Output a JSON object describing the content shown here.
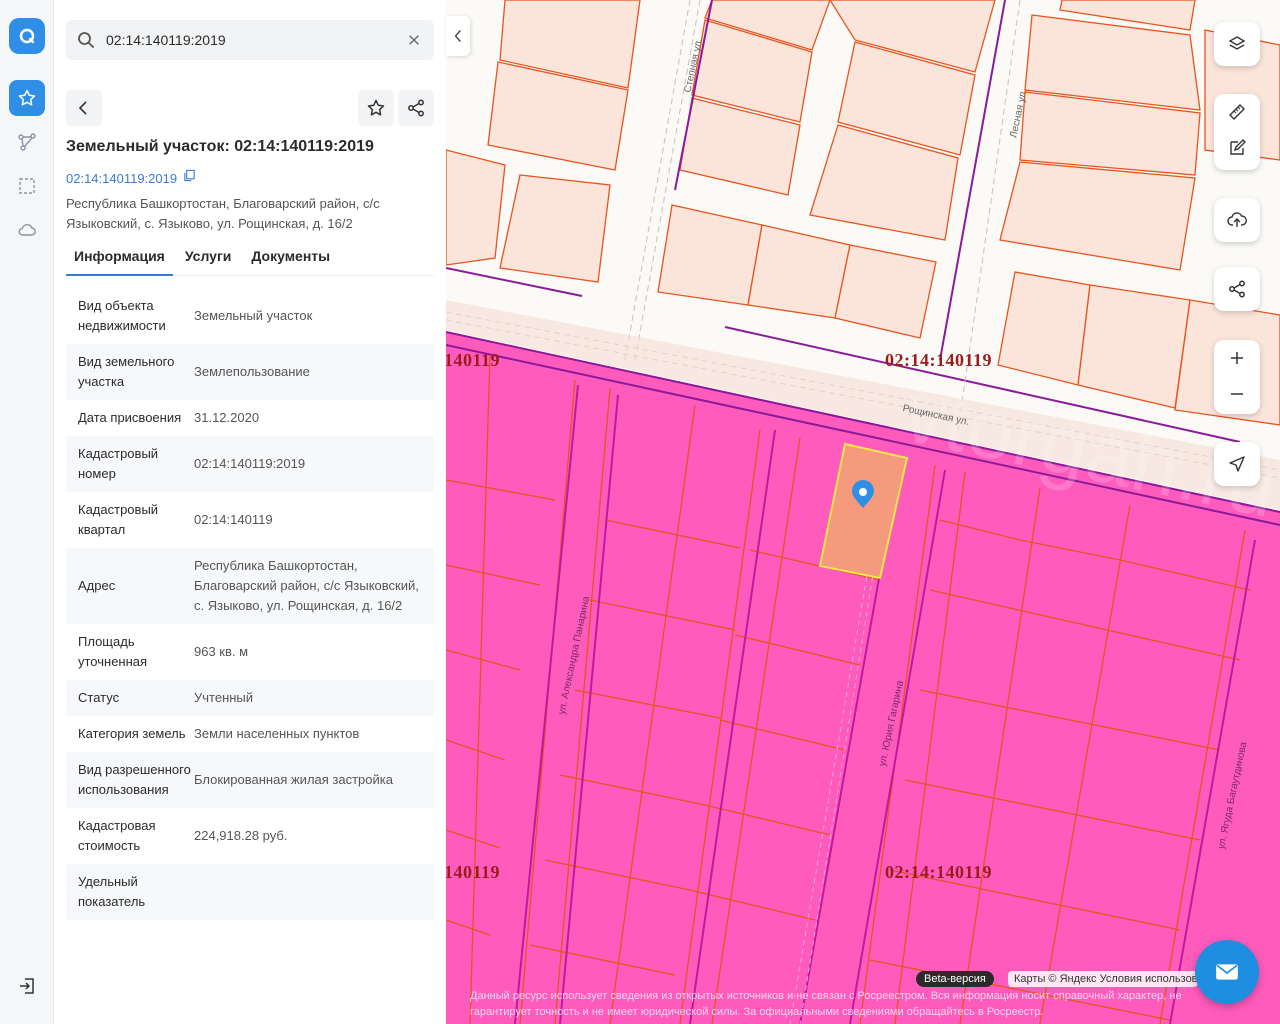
{
  "search": {
    "value": "02:14:140119:2019"
  },
  "object": {
    "title": "Земельный участок: 02:14:140119:2019",
    "cadastral_link": "02:14:140119:2019",
    "address": "Республика Башкортостан, Благоварский район, с/с Языковский, с. Языково, ул. Рощинская, д. 16/2"
  },
  "tabs": [
    {
      "label": "Информация",
      "active": true
    },
    {
      "label": "Услуги",
      "active": false
    },
    {
      "label": "Документы",
      "active": false
    }
  ],
  "info_rows": [
    {
      "key": "Вид объекта недвижимости",
      "value": "Земельный участок"
    },
    {
      "key": "Вид земельного участка",
      "value": "Землепользование"
    },
    {
      "key": "Дата присвоения",
      "value": "31.12.2020"
    },
    {
      "key": "Кадастровый номер",
      "value": "02:14:140119:2019"
    },
    {
      "key": "Кадастровый квартал",
      "value": "02:14:140119"
    },
    {
      "key": "Адрес",
      "value": "Республика Башкортостан, Благоварский район, с/с Языковский, с. Языково, ул. Рощинская, д. 16/2"
    },
    {
      "key": "Площадь уточненная",
      "value": "963 кв. м"
    },
    {
      "key": "Статус",
      "value": "Учтенный"
    },
    {
      "key": "Категория земель",
      "value": "Земли населенных пунктов"
    },
    {
      "key": "Вид разрешенного использования",
      "value": "Блокированная жилая застройка"
    },
    {
      "key": "Кадастровая стоимость",
      "value": "224,918.28 руб."
    },
    {
      "key": "Удельный показатель",
      "value": ""
    }
  ],
  "map": {
    "quarter_label": "02:14:140119",
    "quarter_label_partial": "140119",
    "streets": {
      "stepnaya": "Степная ул.",
      "lesnaya": "Лесная ул.",
      "roshchinskaya": "Рощинская ул.",
      "panarina": "ул. Александра Панарина",
      "gagarina": "ул. Юрия Гагарина",
      "bagautdinova": "ул. Ягуда Багаутдинова"
    },
    "watermark": "vtorgah.ru",
    "beta_badge": "Beta-версия",
    "attribution": "Карты © Яндекс   Условия использования",
    "disclaimer": "Данный ресурс использует сведения из открытых источников и не связан с Росреестром. Вся информация носит справочный характер, не гарантирует точность и не имеет юридической силы. За официальными сведениями обращайтесь в Росреестр."
  },
  "colors": {
    "accent": "#3a7bd5",
    "parcel_fill": "#ff5bbd",
    "parcel_stroke": "#e8541e",
    "selected_fill": "#f59a7c",
    "selected_stroke": "#f5e64a",
    "brand": "#1e8ee0"
  },
  "icons": {
    "rail": [
      "app-logo-icon",
      "star-icon",
      "route-icon",
      "select-area-icon",
      "cloud-icon",
      "logout-icon"
    ],
    "map_controls": [
      "layers-icon",
      "ruler-icon",
      "edit-icon",
      "upload-icon",
      "share-icon",
      "zoom-in-icon",
      "zoom-out-icon",
      "locate-icon"
    ]
  }
}
